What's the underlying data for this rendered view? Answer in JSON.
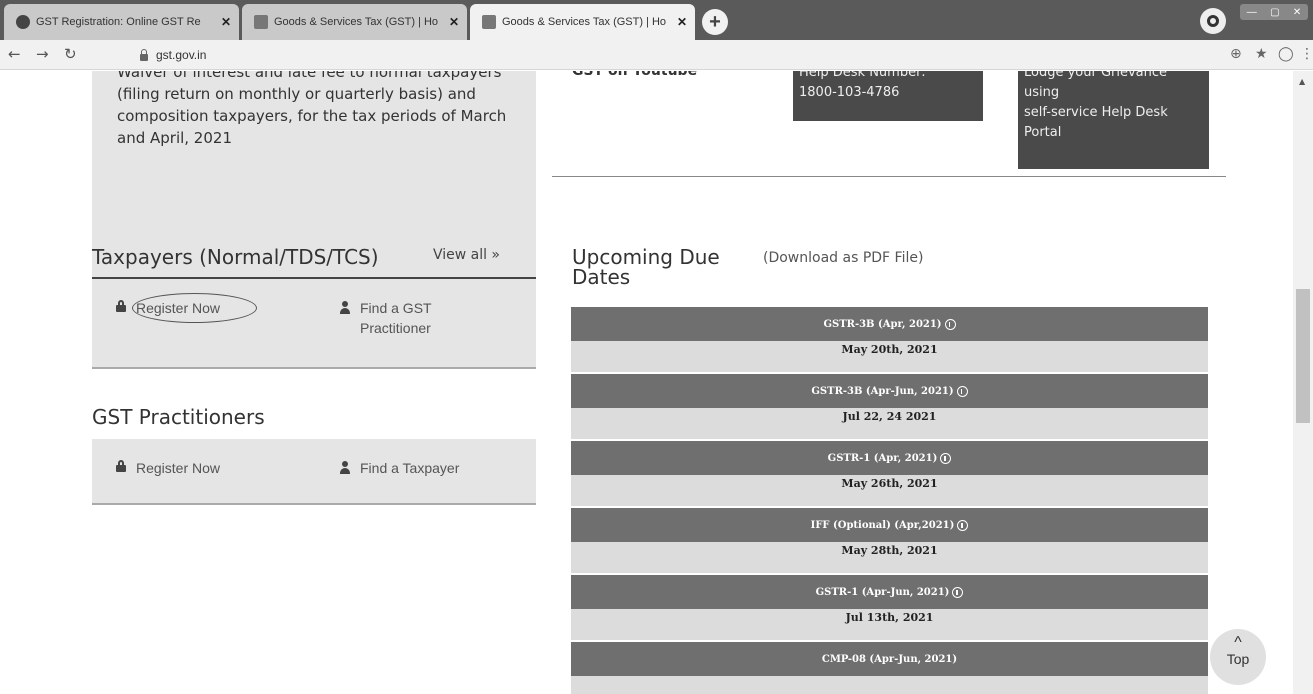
{
  "browser": {
    "tabs": [
      {
        "label": "GST Registration: Online GST Re",
        "active": false
      },
      {
        "label": "Goods & Services Tax (GST) | Ho",
        "active": false
      },
      {
        "label": "Goods & Services Tax (GST) | Ho",
        "active": true
      }
    ],
    "url": "gst.gov.in"
  },
  "news": {
    "text": "Waiver of interest and late fee to normal taxpayers (filing return on monthly or quarterly basis) and composition taxpayers, for the tax periods of March and April, 2021",
    "view_all": "View all »"
  },
  "help": {
    "youtube_label": "GST on Youtube",
    "helpdesk_line1": "Help Desk Number:",
    "helpdesk_number": "1800-103-4786",
    "grievance_line1": "Lodge your Grievance",
    "grievance_line2": "using",
    "grievance_line3": "self-service Help Desk",
    "grievance_line4": "Portal"
  },
  "taxpayers": {
    "title": "Taxpayers (Normal/TDS/TCS)",
    "register": "Register Now",
    "find_line1": "Find a GST",
    "find_line2": "Practitioner"
  },
  "practitioners": {
    "title": "GST Practitioners",
    "register": "Register Now",
    "find": "Find a Taxpayer"
  },
  "due_dates": {
    "title_line1": "Upcoming Due",
    "title_line2": "Dates",
    "pdf_link": "(Download as PDF File)",
    "rows": [
      {
        "form": "GSTR-3B (Apr, 2021)",
        "date": "May 20th, 2021"
      },
      {
        "form": "GSTR-3B (Apr-Jun, 2021)",
        "date": "Jul 22, 24 2021"
      },
      {
        "form": "GSTR-1 (Apr, 2021)",
        "date": "May 26th, 2021"
      },
      {
        "form": "IFF (Optional) (Apr,2021)",
        "date": "May 28th, 2021"
      },
      {
        "form": "GSTR-1 (Apr-Jun, 2021)",
        "date": "Jul 13th, 2021"
      },
      {
        "form": "CMP-08 (Apr-Jun, 2021)",
        "date": ""
      }
    ]
  },
  "top_button": "Top"
}
